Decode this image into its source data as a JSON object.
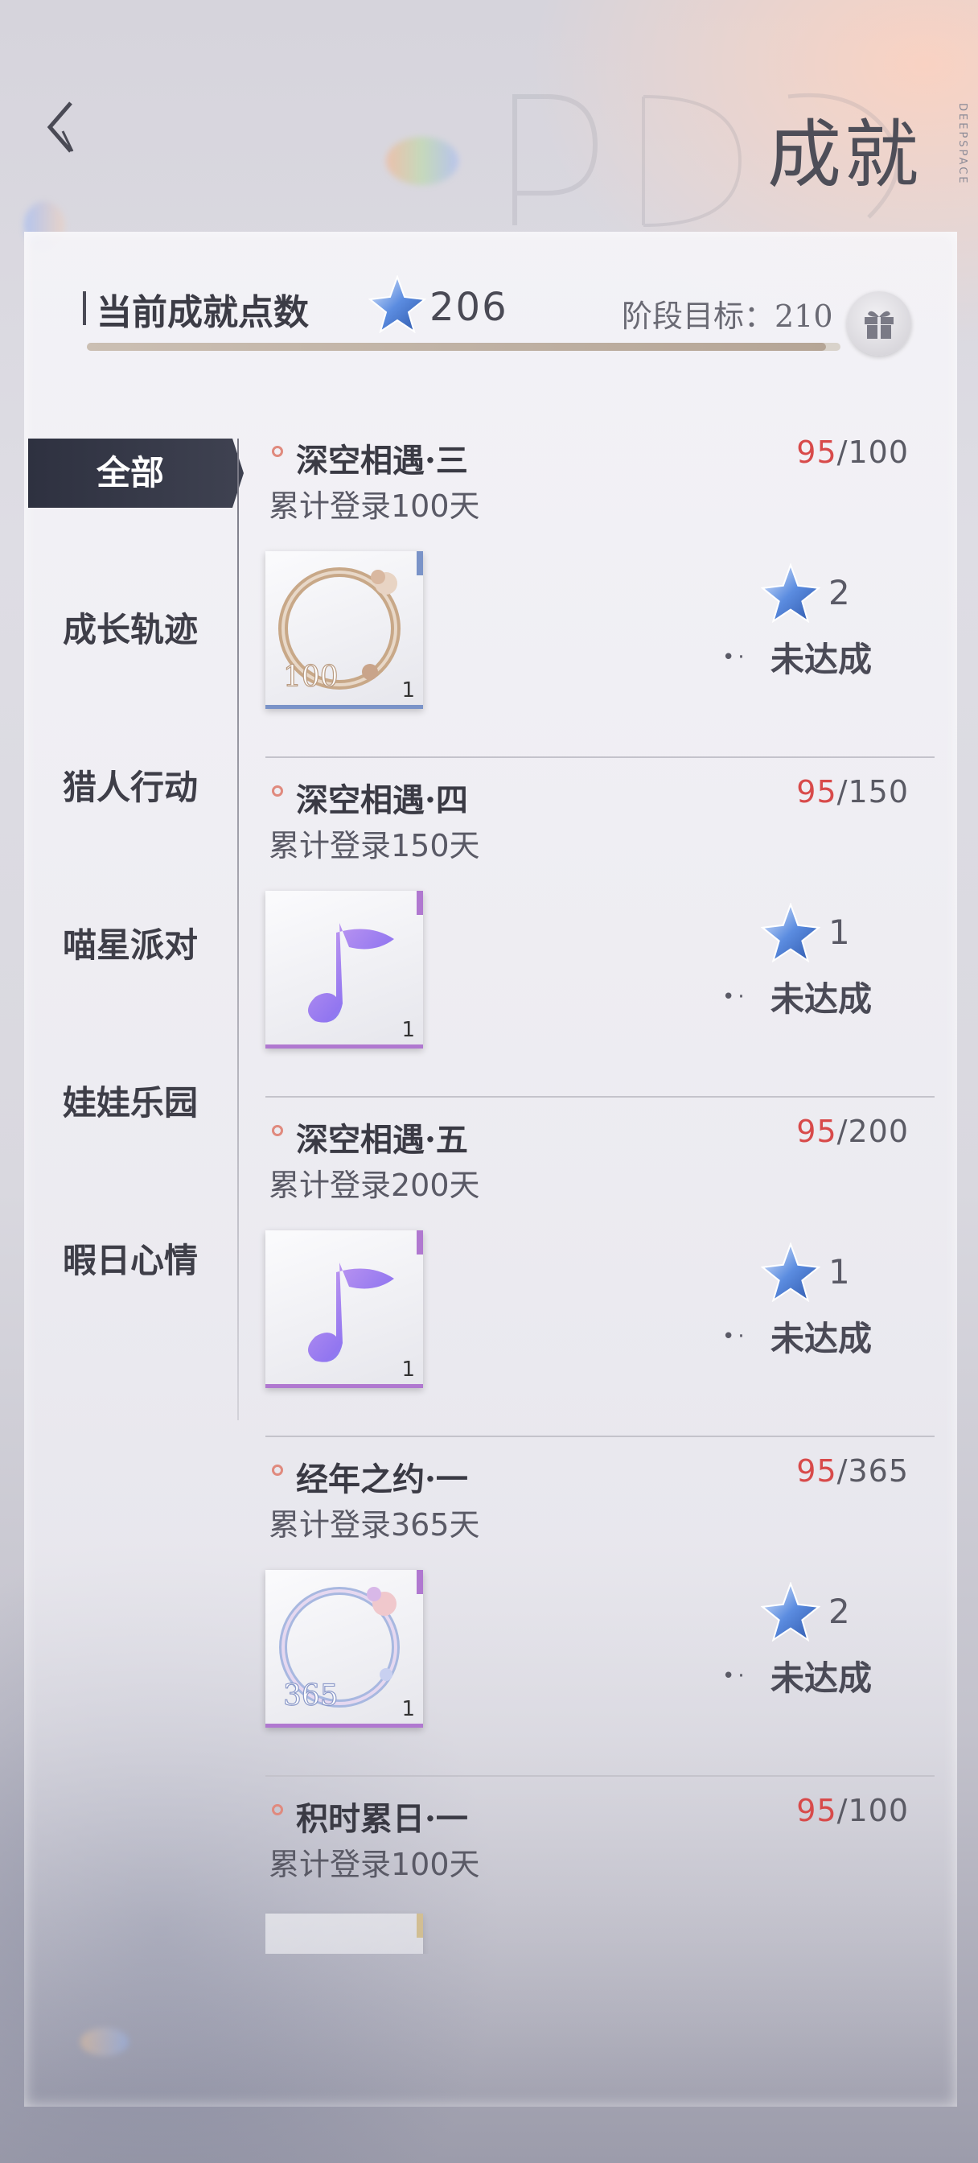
{
  "header": {
    "title": "成就",
    "brand_vertical": "DEEPSPACE"
  },
  "points": {
    "label": "当前成就点数",
    "value": "206",
    "stage_label": "阶段目标：210",
    "progress_fraction": 0.981
  },
  "sidebar": {
    "tabs": [
      {
        "label": "全部",
        "active": true
      },
      {
        "label": "成长轨迹",
        "active": false
      },
      {
        "label": "猎人行动",
        "active": false
      },
      {
        "label": "喵星派对",
        "active": false
      },
      {
        "label": "娃娃乐园",
        "active": false
      },
      {
        "label": "暇日心情",
        "active": false
      }
    ]
  },
  "achievements": [
    {
      "title": "深空相遇·三",
      "progress_current": "95",
      "progress_total": "/100",
      "desc": "累计登录100天",
      "reward_icon": "avatar-frame-100-icon",
      "reward_text": "100",
      "reward_qty": "1",
      "points": "2",
      "status": "未达成",
      "accent": "#7a93c8"
    },
    {
      "title": "深空相遇·四",
      "progress_current": "95",
      "progress_total": "/150",
      "desc": "累计登录150天",
      "reward_icon": "music-note-icon",
      "reward_qty": "1",
      "points": "1",
      "status": "未达成",
      "accent": "#b078d0"
    },
    {
      "title": "深空相遇·五",
      "progress_current": "95",
      "progress_total": "/200",
      "desc": "累计登录200天",
      "reward_icon": "music-note-icon",
      "reward_qty": "1",
      "points": "1",
      "status": "未达成",
      "accent": "#b078d0"
    },
    {
      "title": "经年之约·一",
      "progress_current": "95",
      "progress_total": "/365",
      "desc": "累计登录365天",
      "reward_icon": "avatar-frame-365-icon",
      "reward_text": "365",
      "reward_qty": "1",
      "points": "2",
      "status": "未达成",
      "accent": "#b078d0"
    },
    {
      "title": "积时累日·一",
      "progress_current": "95",
      "progress_total": "/100",
      "desc": "累计登录100天",
      "reward_icon": "reward-item-icon",
      "reward_qty": "",
      "points": "",
      "status": "",
      "accent": "#e0c070"
    }
  ],
  "colors": {
    "progress_current": "#d84a4a",
    "active_tab": "#2e3140",
    "star": "#4c7bd4"
  }
}
